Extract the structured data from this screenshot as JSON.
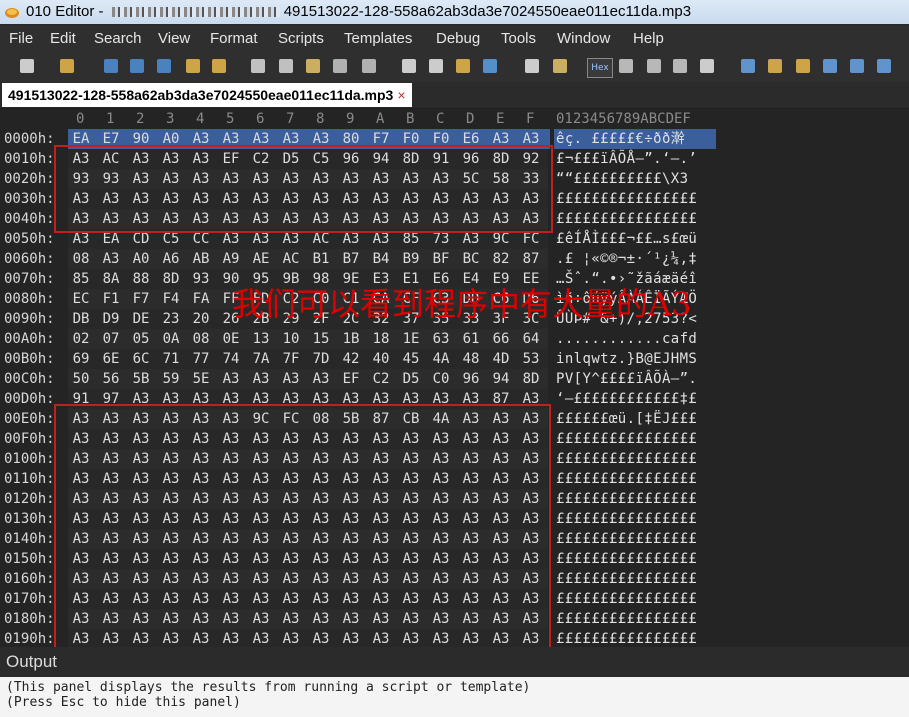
{
  "window": {
    "app_name": "010 Editor - ",
    "file_tail": "491513022-128-558a62ab3da3e7024550eae011ec11da.mp3"
  },
  "menu": [
    "File",
    "Edit",
    "Search",
    "View",
    "Format",
    "Scripts",
    "Templates",
    "Debug",
    "Tools",
    "Window",
    "Help"
  ],
  "toolbar_icons": [
    "new-file-icon",
    "open-file-icon",
    "save-icon",
    "save-as-icon",
    "save-all-icon",
    "open-folder-icon",
    "copy-folder-icon",
    "cut-icon",
    "copy-icon",
    "paste-icon",
    "undo-icon",
    "redo-icon",
    "find-icon",
    "replace-icon",
    "find-in-files-icon",
    "goto-icon",
    "compare-icon",
    "text-mode-icon",
    "hex-mode-icon",
    "byte-grouping-icon",
    "paragraph-icon",
    "columns-icon",
    "highlight-icon",
    "calculator-icon",
    "inspector-icon",
    "convert-icon",
    "histogram-icon",
    "checksum-icon",
    "settings-icon"
  ],
  "toolbar_hex_label": "Hex",
  "tab": {
    "label": "491513022-128-558a62ab3da3e7024550eae011ec11da.mp3",
    "close": "×"
  },
  "hex_header": {
    "columns": [
      "0",
      "1",
      "2",
      "3",
      "4",
      "5",
      "6",
      "7",
      "8",
      "9",
      "A",
      "B",
      "C",
      "D",
      "E",
      "F"
    ],
    "ascii": "0123456789ABCDEF"
  },
  "rows": [
    {
      "addr": "0000h:",
      "bytes": [
        "EA",
        "E7",
        "90",
        "A0",
        "A3",
        "A3",
        "A3",
        "A3",
        "A3",
        "80",
        "F7",
        "F0",
        "F0",
        "E6",
        "A3",
        "A3"
      ],
      "ascii": "êç. £££££€÷ðð澣"
    },
    {
      "addr": "0010h:",
      "bytes": [
        "A3",
        "AC",
        "A3",
        "A3",
        "A3",
        "EF",
        "C2",
        "D5",
        "C5",
        "96",
        "94",
        "8D",
        "91",
        "96",
        "8D",
        "92"
      ],
      "ascii": "£¬£££ïÂÕÅ–”.‘–.’"
    },
    {
      "addr": "0020h:",
      "bytes": [
        "93",
        "93",
        "A3",
        "A3",
        "A3",
        "A3",
        "A3",
        "A3",
        "A3",
        "A3",
        "A3",
        "A3",
        "A3",
        "5C",
        "58",
        "33"
      ],
      "ascii": "““££££££££££\\X3"
    },
    {
      "addr": "0030h:",
      "bytes": [
        "A3",
        "A3",
        "A3",
        "A3",
        "A3",
        "A3",
        "A3",
        "A3",
        "A3",
        "A3",
        "A3",
        "A3",
        "A3",
        "A3",
        "A3",
        "A3"
      ],
      "ascii": "££££££££££££££££"
    },
    {
      "addr": "0040h:",
      "bytes": [
        "A3",
        "A3",
        "A3",
        "A3",
        "A3",
        "A3",
        "A3",
        "A3",
        "A3",
        "A3",
        "A3",
        "A3",
        "A3",
        "A3",
        "A3",
        "A3"
      ],
      "ascii": "££££££££££££££££"
    },
    {
      "addr": "0050h:",
      "bytes": [
        "A3",
        "EA",
        "CD",
        "C5",
        "CC",
        "A3",
        "A3",
        "A3",
        "AC",
        "A3",
        "A3",
        "85",
        "73",
        "A3",
        "9C",
        "FC"
      ],
      "ascii": "£êÍÅÌ£££¬££…s£œü"
    },
    {
      "addr": "0060h:",
      "bytes": [
        "08",
        "A3",
        "A0",
        "A6",
        "AB",
        "A9",
        "AE",
        "AC",
        "B1",
        "B7",
        "B4",
        "B9",
        "BF",
        "BC",
        "82",
        "87"
      ],
      "ascii": ".£ ¦«©®¬±·´¹¿¼‚‡"
    },
    {
      "addr": "0070h:",
      "bytes": [
        "85",
        "8A",
        "88",
        "8D",
        "93",
        "90",
        "95",
        "9B",
        "98",
        "9E",
        "E3",
        "E1",
        "E6",
        "E4",
        "E9",
        "EE"
      ],
      "ascii": "…Šˆ.“.•›˜žãáæäéî"
    },
    {
      "addr": "0080h:",
      "bytes": [
        "EC",
        "F1",
        "F7",
        "F4",
        "FA",
        "FF",
        "FD",
        "C2",
        "C0",
        "C1",
        "CA",
        "CF",
        "C3",
        "DD",
        "C6",
        "D6"
      ],
      "ascii": "ìñ÷ôúÿýÂÀÁÊÏÃÝÆÖ"
    },
    {
      "addr": "0090h:",
      "bytes": [
        "DB",
        "D9",
        "DE",
        "23",
        "20",
        "26",
        "2B",
        "29",
        "2F",
        "2C",
        "32",
        "37",
        "35",
        "33",
        "3F",
        "3C"
      ],
      "ascii": "ÛÙÞ# &+)/,2753?<"
    },
    {
      "addr": "00A0h:",
      "bytes": [
        "02",
        "07",
        "05",
        "0A",
        "08",
        "0E",
        "13",
        "10",
        "15",
        "1B",
        "18",
        "1E",
        "63",
        "61",
        "66",
        "64"
      ],
      "ascii": "............cafd"
    },
    {
      "addr": "00B0h:",
      "bytes": [
        "69",
        "6E",
        "6C",
        "71",
        "77",
        "74",
        "7A",
        "7F",
        "7D",
        "42",
        "40",
        "45",
        "4A",
        "48",
        "4D",
        "53"
      ],
      "ascii": "inlqwtz.}B@EJHMS"
    },
    {
      "addr": "00C0h:",
      "bytes": [
        "50",
        "56",
        "5B",
        "59",
        "5E",
        "A3",
        "A3",
        "A3",
        "A3",
        "EF",
        "C2",
        "D5",
        "C0",
        "96",
        "94",
        "8D"
      ],
      "ascii": "PV[Y^££££ïÂÕÀ–”."
    },
    {
      "addr": "00D0h:",
      "bytes": [
        "91",
        "97",
        "A3",
        "A3",
        "A3",
        "A3",
        "A3",
        "A3",
        "A3",
        "A3",
        "A3",
        "A3",
        "A3",
        "A3",
        "87",
        "A3"
      ],
      "ascii": "‘—££££££££££££‡£"
    },
    {
      "addr": "00E0h:",
      "bytes": [
        "A3",
        "A3",
        "A3",
        "A3",
        "A3",
        "A3",
        "9C",
        "FC",
        "08",
        "5B",
        "87",
        "CB",
        "4A",
        "A3",
        "A3",
        "A3"
      ],
      "ascii": "££££££œü.[‡ËJ£££"
    },
    {
      "addr": "00F0h:",
      "bytes": [
        "A3",
        "A3",
        "A3",
        "A3",
        "A3",
        "A3",
        "A3",
        "A3",
        "A3",
        "A3",
        "A3",
        "A3",
        "A3",
        "A3",
        "A3",
        "A3"
      ],
      "ascii": "££££££££££££££££"
    },
    {
      "addr": "0100h:",
      "bytes": [
        "A3",
        "A3",
        "A3",
        "A3",
        "A3",
        "A3",
        "A3",
        "A3",
        "A3",
        "A3",
        "A3",
        "A3",
        "A3",
        "A3",
        "A3",
        "A3"
      ],
      "ascii": "££££££££££££££££"
    },
    {
      "addr": "0110h:",
      "bytes": [
        "A3",
        "A3",
        "A3",
        "A3",
        "A3",
        "A3",
        "A3",
        "A3",
        "A3",
        "A3",
        "A3",
        "A3",
        "A3",
        "A3",
        "A3",
        "A3"
      ],
      "ascii": "££££££££££££££££"
    },
    {
      "addr": "0120h:",
      "bytes": [
        "A3",
        "A3",
        "A3",
        "A3",
        "A3",
        "A3",
        "A3",
        "A3",
        "A3",
        "A3",
        "A3",
        "A3",
        "A3",
        "A3",
        "A3",
        "A3"
      ],
      "ascii": "££££££££££££££££"
    },
    {
      "addr": "0130h:",
      "bytes": [
        "A3",
        "A3",
        "A3",
        "A3",
        "A3",
        "A3",
        "A3",
        "A3",
        "A3",
        "A3",
        "A3",
        "A3",
        "A3",
        "A3",
        "A3",
        "A3"
      ],
      "ascii": "££££££££££££££££"
    },
    {
      "addr": "0140h:",
      "bytes": [
        "A3",
        "A3",
        "A3",
        "A3",
        "A3",
        "A3",
        "A3",
        "A3",
        "A3",
        "A3",
        "A3",
        "A3",
        "A3",
        "A3",
        "A3",
        "A3"
      ],
      "ascii": "££££££££££££££££"
    },
    {
      "addr": "0150h:",
      "bytes": [
        "A3",
        "A3",
        "A3",
        "A3",
        "A3",
        "A3",
        "A3",
        "A3",
        "A3",
        "A3",
        "A3",
        "A3",
        "A3",
        "A3",
        "A3",
        "A3"
      ],
      "ascii": "££££££££££££££££"
    },
    {
      "addr": "0160h:",
      "bytes": [
        "A3",
        "A3",
        "A3",
        "A3",
        "A3",
        "A3",
        "A3",
        "A3",
        "A3",
        "A3",
        "A3",
        "A3",
        "A3",
        "A3",
        "A3",
        "A3"
      ],
      "ascii": "££££££££££££££££"
    },
    {
      "addr": "0170h:",
      "bytes": [
        "A3",
        "A3",
        "A3",
        "A3",
        "A3",
        "A3",
        "A3",
        "A3",
        "A3",
        "A3",
        "A3",
        "A3",
        "A3",
        "A3",
        "A3",
        "A3"
      ],
      "ascii": "££££££££££££££££"
    },
    {
      "addr": "0180h:",
      "bytes": [
        "A3",
        "A3",
        "A3",
        "A3",
        "A3",
        "A3",
        "A3",
        "A3",
        "A3",
        "A3",
        "A3",
        "A3",
        "A3",
        "A3",
        "A3",
        "A3"
      ],
      "ascii": "££££££££££££££££"
    },
    {
      "addr": "0190h:",
      "bytes": [
        "A3",
        "A3",
        "A3",
        "A3",
        "A3",
        "A3",
        "A3",
        "A3",
        "A3",
        "A3",
        "A3",
        "A3",
        "A3",
        "A3",
        "A3",
        "A3"
      ],
      "ascii": "££££££££££££££££"
    }
  ],
  "selection": {
    "row": 0,
    "first_byte": 0,
    "last_byte": 15
  },
  "annotation": "我们可以看到程序中有大量的A3",
  "output": {
    "title": "Output",
    "line1": "(This panel displays the results from running a script or template)",
    "line2": "(Press Esc to hide this panel)"
  },
  "colors": {
    "highlight_box": "#c21f1f",
    "annotation_text": "#e00000",
    "selection": "#3a5f9a"
  }
}
